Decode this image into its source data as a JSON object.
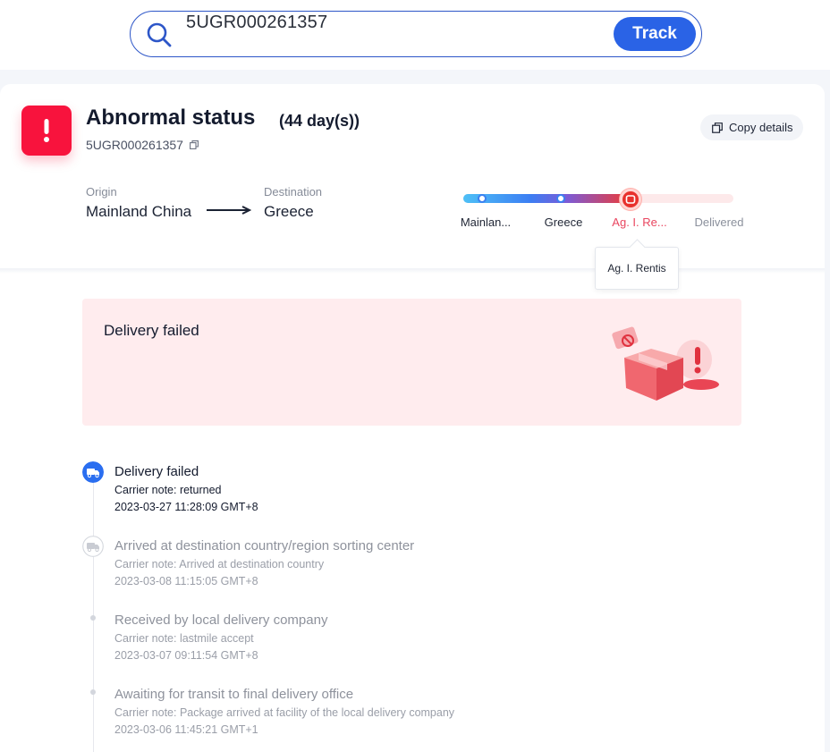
{
  "search": {
    "value": "5UGR000261357",
    "track_label": "Track"
  },
  "shipment": {
    "status_title": "Abnormal status",
    "status_days": "(44 day(s))",
    "tracking_number": "5UGR000261357",
    "copy_details_label": "Copy details"
  },
  "route": {
    "origin_label": "Origin",
    "origin_value": "Mainland China",
    "destination_label": "Destination",
    "destination_value": "Greece"
  },
  "progress": {
    "fraction": 0.62,
    "stages": [
      {
        "label": "Mainlan..."
      },
      {
        "label": "Greece"
      },
      {
        "label": "Ag. I. Re..."
      },
      {
        "label": "Delivered"
      }
    ],
    "tooltip": "Ag. I. Rentis"
  },
  "banner": {
    "title": "Delivery failed"
  },
  "events": [
    {
      "title": "Delivery failed",
      "note": "Carrier note: returned",
      "time": "2023-03-27 11:28:09 GMT+8"
    },
    {
      "title": "Arrived at destination country/region sorting center",
      "note": "Carrier note: Arrived at destination country",
      "time": "2023-03-08 11:15:05 GMT+8"
    },
    {
      "title": "Received by local delivery company",
      "note": "Carrier note: lastmile accept",
      "time": "2023-03-07 09:11:54 GMT+8"
    },
    {
      "title": "Awaiting for transit to final delivery office",
      "note": "Carrier note: Package arrived at facility of the local delivery company",
      "time": "2023-03-06 11:45:21 GMT+1"
    }
  ],
  "colors": {
    "accent": "#2a63e6",
    "alert": "#f8133d",
    "banner_bg": "#ffecee",
    "current_stage": "#e9455f"
  },
  "icons": {
    "search": "search-icon",
    "alert": "exclamation-icon",
    "copy": "copy-icon",
    "truck": "truck-icon",
    "arrow": "arrow-right-icon"
  }
}
